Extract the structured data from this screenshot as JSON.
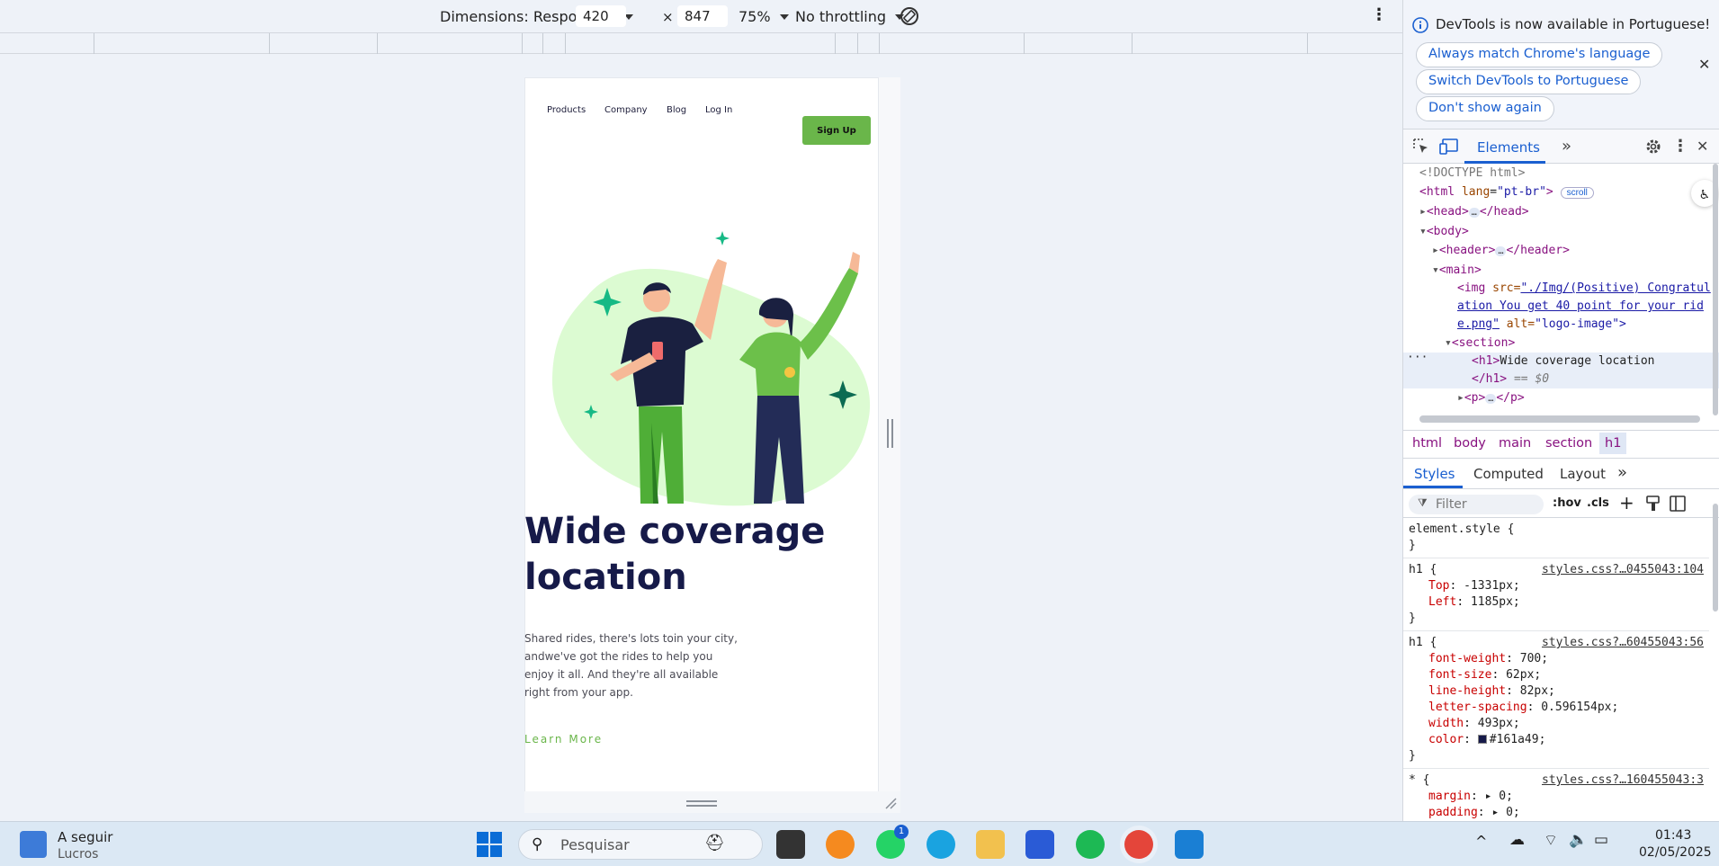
{
  "device_toolbar": {
    "dimensions_label": "Dimensions: Responsive",
    "width_value": "420",
    "times": "×",
    "height_value": "847",
    "zoom": "75%",
    "throttling": "No throttling",
    "more_glyph": "⋮"
  },
  "site": {
    "nav": [
      "Products",
      "Company",
      "Blog",
      "Log In"
    ],
    "signup_label": "Sign Up",
    "hero_image_alt": "logo-image",
    "heading": "Wide coverage location",
    "paragraph": "Shared rides, there's lots toin your city, andwe've got the rides to help you enjoy it all. And they're all available right from your app.",
    "learn_more": "Learn More",
    "colors": {
      "heading": "#161a49",
      "accent": "#6ab64a",
      "blob": "#dcfbd2"
    }
  },
  "devtools": {
    "banner": {
      "message": "DevTools is now available in Portuguese!",
      "buttons": [
        "Always match Chrome's language",
        "Switch DevTools to Portuguese",
        "Don't show again"
      ],
      "close_glyph": "✕"
    },
    "tabs": {
      "elements": "Elements",
      "more": "»"
    },
    "dom": {
      "doctype": "<!DOCTYPE html>",
      "html_open": "<html",
      "lang_attr": "lang",
      "lang_val": "\"pt-br\"",
      "scroll_badge": "scroll",
      "head": "<head>",
      "head_close": "</head>",
      "body": "<body>",
      "header": "<header>",
      "header_close": "</header>",
      "main": "<main>",
      "img_open": "<img",
      "src_attr": "src=",
      "src_val": "\"./Img/(Positive) Congratulation You get 40 point for your ride.png\"",
      "alt_attr": "alt=",
      "alt_val": "\"logo-image\">",
      "section": "<section>",
      "h1_open": "<h1>",
      "h1_text": "Wide coverage location",
      "h1_close": "</h1>",
      "eq": "== $0",
      "p_open": "<p>",
      "p_close": "</p>",
      "ellipsis": "…"
    },
    "breadcrumbs": [
      "html",
      "body",
      "main",
      "section",
      "h1"
    ],
    "style_tabs": [
      "Styles",
      "Computed",
      "Layout",
      "»"
    ],
    "filter_placeholder": "Filter",
    "hov": ":hov",
    "cls": ".cls",
    "rules": [
      {
        "selector": "element.style {",
        "source": "",
        "decls": [],
        "close": "}"
      },
      {
        "selector": "h1 {",
        "source": "styles.css?…0455043:104",
        "decls": [
          [
            "Top",
            "-1331px;"
          ],
          [
            "Left",
            "1185px;"
          ]
        ],
        "close": "}"
      },
      {
        "selector": "h1 {",
        "source": "styles.css?…60455043:56",
        "decls": [
          [
            "font-weight",
            "700;"
          ],
          [
            "font-size",
            "62px;"
          ],
          [
            "line-height",
            "82px;"
          ],
          [
            "letter-spacing",
            "0.596154px;"
          ],
          [
            "width",
            "493px;"
          ],
          [
            "color",
            "#161a49;"
          ]
        ],
        "close": "}"
      },
      {
        "selector": "* {",
        "source": "styles.css?…160455043:3",
        "decls": [
          [
            "margin",
            "▸ 0;"
          ],
          [
            "padding",
            "▸ 0;"
          ]
        ],
        "close": ""
      }
    ]
  },
  "taskbar": {
    "widget_title": "A seguir",
    "widget_sub": "Lucros",
    "search_placeholder": "Pesquisar",
    "whatsapp_badge": "1",
    "time": "01:43",
    "date": "02/05/2025",
    "chevron": "^"
  }
}
